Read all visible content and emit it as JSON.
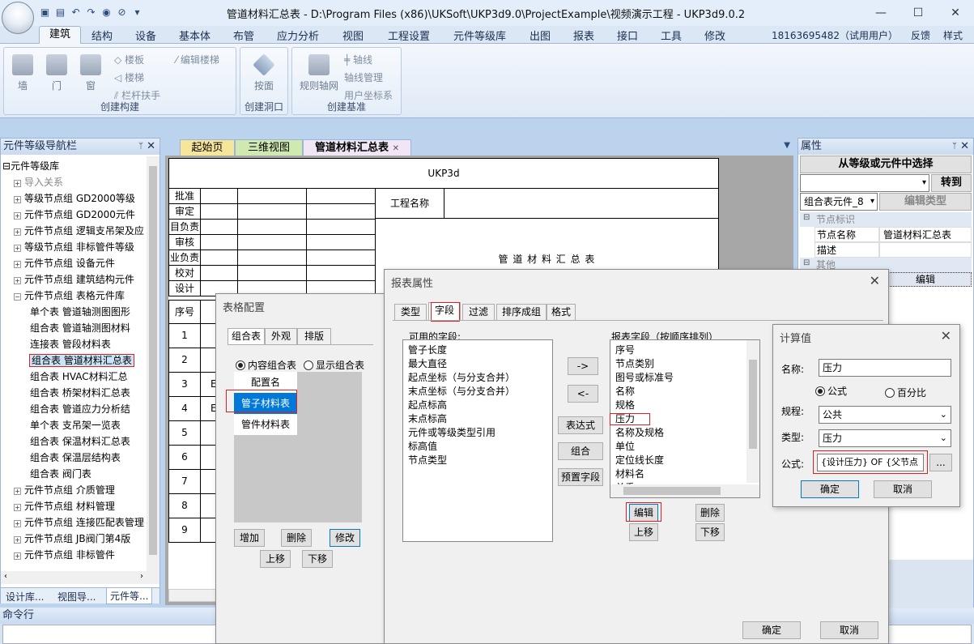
{
  "window": {
    "title": "管道材料汇总表 - D:\\Program Files (x86)\\UKSoft\\UKP3d9.0\\ProjectExample\\视频演示工程 - UKP3d9.0.2",
    "minimize": "—",
    "maximize": "☐",
    "close": "✕"
  },
  "menu": {
    "tabs": [
      "建筑",
      "结构",
      "设备",
      "基本体",
      "布管",
      "应力分析",
      "视图",
      "工程设置",
      "元件等级库",
      "出图",
      "报表",
      "接口",
      "工具",
      "修改"
    ],
    "user": "18163695482（试用用户）",
    "feedback": "反馈",
    "style": "样式"
  },
  "ribbon": {
    "groups": [
      {
        "label": "创建构建",
        "big": [
          "墙",
          "门",
          "窗"
        ],
        "small": [
          "楼板",
          "楼梯",
          "栏杆扶手",
          "编辑楼梯"
        ]
      },
      {
        "label": "创建洞口",
        "big": [
          "按面"
        ]
      },
      {
        "label": "创建基准",
        "big": [
          "规则轴网"
        ],
        "small": [
          "轴线",
          "轴线管理",
          "用户坐标系"
        ]
      }
    ]
  },
  "nav": {
    "title": "元件等级导航栏",
    "pin": "ᛘ",
    "close": "✕",
    "root": "元件等级库",
    "items": [
      {
        "label": "导入关系",
        "level": 1,
        "gray": true
      },
      {
        "label": "等级节点组 GD2000等级",
        "level": 1
      },
      {
        "label": "元件节点组 GD2000元件",
        "level": 1
      },
      {
        "label": "元件节点组 逻辑支吊架及应",
        "level": 1
      },
      {
        "label": "等级节点组 非标管件等级",
        "level": 1
      },
      {
        "label": "元件节点组 设备元件",
        "level": 1
      },
      {
        "label": "元件节点组 建筑结构元件",
        "level": 1
      },
      {
        "label": "元件节点组 表格元件库",
        "level": 1,
        "open": true
      },
      {
        "label": "单个表 管道轴测图图形",
        "level": 2
      },
      {
        "label": "组合表 管道轴测图材料",
        "level": 2
      },
      {
        "label": "连接表 管段材料表",
        "level": 2
      },
      {
        "label": "组合表 管道材料汇总表",
        "level": 2,
        "selected": true
      },
      {
        "label": "组合表 HVAC材料汇总",
        "level": 2
      },
      {
        "label": "组合表 桥架材料汇总表",
        "level": 2
      },
      {
        "label": "组合表 管道应力分析结",
        "level": 2
      },
      {
        "label": "单个表 支吊架一览表",
        "level": 2
      },
      {
        "label": "组合表 保温材料汇总表",
        "level": 2
      },
      {
        "label": "组合表 保温层结构表",
        "level": 2
      },
      {
        "label": "组合表 阀门表",
        "level": 2
      },
      {
        "label": "元件节点组 介质管理",
        "level": 1
      },
      {
        "label": "元件节点组 材料管理",
        "level": 1
      },
      {
        "label": "元件节点组 连接匹配表管理",
        "level": 1
      },
      {
        "label": "元件节点组 JB阀门第4版",
        "level": 1
      },
      {
        "label": "元件节点组 非标管件",
        "level": 1
      }
    ],
    "bottom_tabs": [
      "设计库...",
      "视图导...",
      "元件等..."
    ]
  },
  "command": {
    "title": "命令行"
  },
  "doc": {
    "tabs": [
      "起始页",
      "三维视图",
      "管道材料汇总表"
    ],
    "tab_close": "✕",
    "sheet": {
      "company": "UKP3d",
      "sign_rows": [
        "批准",
        "审定",
        "目负责",
        "审核",
        "业负责",
        "校对",
        "设计"
      ],
      "project_label": "工程名称",
      "table_title": "管 道 材 料 汇 总 表",
      "col_header": "序号",
      "row_numbers": [
        "1",
        "2",
        "3",
        "4",
        "5",
        "6",
        "7",
        "8",
        "9"
      ],
      "row_frag": [
        "E",
        "E"
      ]
    }
  },
  "props": {
    "title": "属性",
    "select_btn": "从等级或元件中选择",
    "goto_btn": "转到",
    "combo": "组合表元件_8",
    "edit_type": "编辑类型",
    "section1": "节点标识",
    "rows": [
      {
        "k": "节点名称",
        "v": "管道材料汇总表"
      },
      {
        "k": "描述",
        "v": ""
      }
    ],
    "section2": "其他",
    "edit_row": "编辑"
  },
  "dlg_table": {
    "title": "表格配置",
    "tabs": [
      "组合表",
      "外观",
      "排版"
    ],
    "radio_content": "内容组合表",
    "radio_display": "显示组合表",
    "list_header": "配置名",
    "items": [
      "管子材料表",
      "管件材料表"
    ],
    "buttons": [
      "增加",
      "删除",
      "修改"
    ],
    "move": [
      "上移",
      "下移"
    ]
  },
  "dlg_report": {
    "title": "报表属性",
    "tabs": [
      "类型",
      "字段",
      "过滤",
      "排序成组",
      "格式"
    ],
    "available_label": "可用的字段:",
    "available": [
      "管子长度",
      "最大直径",
      "起点坐标（与分支合并）",
      "末点坐标（与分支合并）",
      "起点标高",
      "末点标高",
      "元件或等级类型引用",
      "标高值",
      "节点类型"
    ],
    "arrows": [
      "->",
      "<-"
    ],
    "mid_buttons": [
      "表达式",
      "组合",
      "预置字段"
    ],
    "report_label": "报表字段（按顺序排列）",
    "report": [
      "序号",
      "节点类别",
      "图号或标准号",
      "名称",
      "规格",
      "压力",
      "名称及规格",
      "单位",
      "定位线长度",
      "材料名",
      "单重"
    ],
    "edit": "编辑",
    "del": "删除",
    "up": "上移",
    "down": "下移",
    "ok": "确定",
    "cancel": "取消"
  },
  "dlg_calc": {
    "title": "计算值",
    "name_label": "名称:",
    "name": "压力",
    "radio_formula": "公式",
    "radio_percent": "百分比",
    "rule_label": "规程:",
    "rule": "公共",
    "type_label": "类型:",
    "type": "压力",
    "formula_label": "公式:",
    "formula": "{设计压力} OF {父节点",
    "dots": "...",
    "ok": "确定",
    "cancel": "取消"
  }
}
